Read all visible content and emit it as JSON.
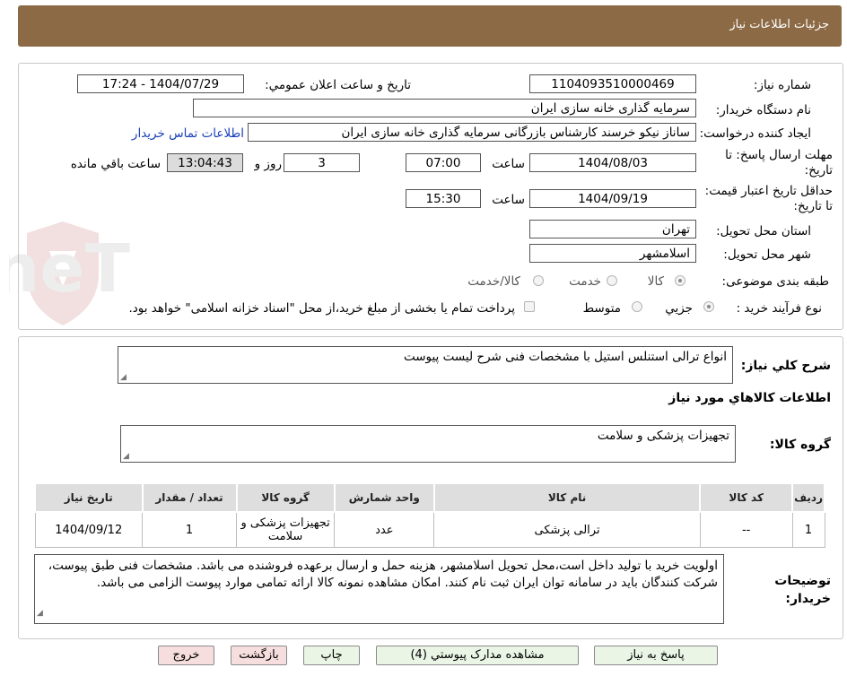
{
  "header": {
    "title": "جزئیات اطلاعات نیاز"
  },
  "watermark": {
    "text": "AriaTender.neT"
  },
  "form": {
    "need_number_label": "شماره نیاز:",
    "need_number": "1104093510000469",
    "announce_label": "تاریخ و ساعت اعلان عمومي:",
    "announce_value": "1404/07/29 - 17:24",
    "buyer_org_label": "نام دستگاه خريدار:",
    "buyer_org": "سرمايه گذاری خانه سازی ايران",
    "creator_label": "ايجاد کننده درخواست:",
    "creator": "ساناز نيکو خرسند کارشناس بازرگانی سرمايه گذاری خانه سازی ايران",
    "contact_link": "اطلاعات تماس خريدار",
    "deadline_label": "مهلت ارسال پاسخ: تا تاريخ:",
    "deadline_date": "1404/08/03",
    "time_label": "ساعت",
    "deadline_time": "07:00",
    "days": "3",
    "days_label": "روز و",
    "remaining_time": "13:04:43",
    "remaining_label": "ساعت باقي مانده",
    "validity_label": "حداقل تاريخ اعتبار قيمت: تا تاريخ:",
    "validity_date": "1404/09/19",
    "validity_time_label": "ساعت",
    "validity_time": "15:30",
    "province_label": "استان محل تحويل:",
    "province": "تهران",
    "city_label": "شهر محل تحويل:",
    "city": "اسلامشهر",
    "category_label": "طبقه بندی موضوعی:",
    "category_options": [
      "کالا",
      "خدمت",
      "کالا/خدمت"
    ],
    "process_label": "نوع فرآيند خريد :",
    "process_options": [
      "جزيي",
      "متوسط"
    ],
    "payment_note": "پرداخت تمام يا بخشی از مبلغ خريد،از محل \"اسناد خزانه اسلامی\" خواهد بود."
  },
  "summary": {
    "general_desc_label": "شرح کلي نياز:",
    "general_desc": "انواع ترالی استنلس استیل با مشخصات فنی شرح لیست پیوست",
    "goods_info_title": "اطلاعات کالاهاي مورد نياز",
    "goods_group_label": "گروه کالا:",
    "goods_group": "تجهيزات پزشکی و سلامت"
  },
  "table": {
    "headers": [
      "رديف",
      "کد کالا",
      "نام کالا",
      "واحد شمارش",
      "گروه کالا",
      "تعداد / مقدار",
      "تاريخ نياز"
    ],
    "rows": [
      [
        "1",
        "--",
        "ترالی پزشکی",
        "عدد",
        "تجهيزات پزشکی و سلامت",
        "1",
        "1404/09/12"
      ]
    ]
  },
  "buyer_notes": {
    "label": "توضيحات خريدار:",
    "text": "اولویت خرید با تولید داخل است،محل تحویل اسلامشهر، هزینه حمل و ارسال برعهده فروشنده می باشد. مشخصات فنی طبق پیوست، شرکت کنندگان باید در سامانه توان ایران ثبت نام کنند. امکان مشاهده نمونه کالا ارائه تمامی موارد پیوست الزامی می باشد."
  },
  "buttons": {
    "reply": "پاسخ به نياز",
    "attachments": "مشاهده مدارک پيوستي (4)",
    "print": "چاپ",
    "back": "بازگشت",
    "exit": "خروج"
  }
}
